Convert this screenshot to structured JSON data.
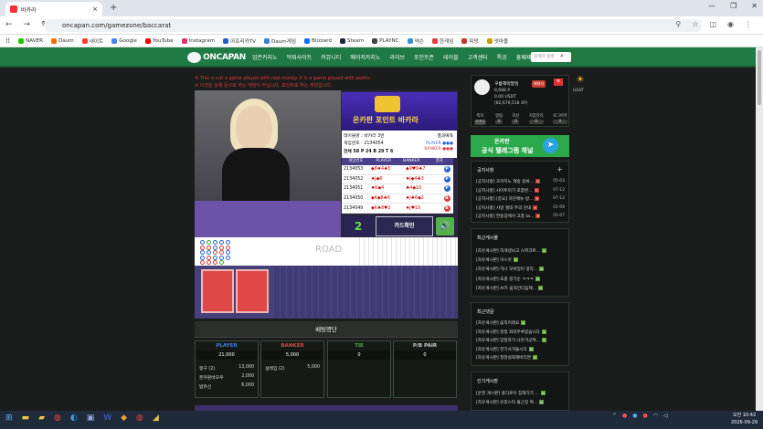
{
  "browser": {
    "tab_title": "바카라",
    "url": "oncapan.com/gamezone/baccarat"
  },
  "bookmarks": [
    "NAVER",
    "Daum",
    "네이트",
    "Google",
    "YouTube",
    "Instagram",
    "아프리카TV",
    "Daum게임",
    "Blizzard",
    "Steam",
    "PLAYNC",
    "넥슨",
    "한게임",
    "피망",
    "넷마블"
  ],
  "bookmark_colors": [
    "#1ec800",
    "#ff6a00",
    "#ff3b30",
    "#4285f4",
    "#ff0000",
    "#e1306c",
    "#1d5fc5",
    "#3f7cd8",
    "#0d6efd",
    "#1b2838",
    "#444",
    "#3b8ed8",
    "#e23b3b",
    "#c0392b",
    "#c9a000"
  ],
  "site": {
    "logo": "ONCAPAN",
    "menu": [
      "업존카지노",
      "먹튀사이트",
      "커뮤니티",
      "메이저카지노",
      "라이브",
      "포인트존",
      "테이블",
      "고객센터",
      "특공",
      "흥페제크"
    ],
    "search_placeholder": "검색어 입력",
    "light_label": "LIGHT"
  },
  "notices": [
    "※ This is not a game played with real money. It is a game played with points.",
    "※ 이것은 실제 돈으로 하는 게임이 아닙니다. 포인트로 하는 게임입니다."
  ],
  "game": {
    "banner": "온카판 포인트 바카라",
    "table_name": "테이블명 : 바카라 3번",
    "round": "게임번호 : 2134054",
    "stats": "전체 58 P 24 B 29 T 6",
    "result_label": "결과예측",
    "legend": [
      "PLAYER",
      "BANKER"
    ],
    "history_headers": [
      "게임번호",
      "PLAYER",
      "BANKER",
      "결과"
    ],
    "history": [
      {
        "id": "2134053",
        "player": "◆8♠4♣5",
        "banker": "◆9♥9♠7",
        "result": "P",
        "color": "#2563d4"
      },
      {
        "id": "2134052",
        "player": "♠J◆6",
        "banker": "♠J◆4♣3",
        "result": "P",
        "color": "#2563d4"
      },
      {
        "id": "2134051",
        "player": "♠K◆4",
        "banker": "♣4◆10",
        "result": "P",
        "color": "#2563d4"
      },
      {
        "id": "2134050",
        "player": "◆K◆8♣6",
        "banker": "♠J♣6◆2",
        "result": "B",
        "color": "#d43b3b"
      },
      {
        "id": "2134049",
        "player": "◆K♣8♥2",
        "banker": "♠J♥10",
        "result": "B",
        "color": "#d43b3b"
      }
    ],
    "countdown": "2",
    "card_button": "카드확인",
    "road_label": "ROAD"
  },
  "betting": {
    "title": "베팅명단",
    "columns": [
      {
        "name": "PLAYER",
        "color": "#3d7fe0",
        "total": "21,000",
        "rows": [
          {
            "user": "짱구 (2)",
            "amount": "13,000"
          },
          {
            "user": "온카판바오우",
            "amount": "2,000"
          },
          {
            "user": "밥쥬신",
            "amount": "6,000"
          }
        ]
      },
      {
        "name": "BANKER",
        "color": "#e04646",
        "total": "5,000",
        "rows": [
          {
            "user": "설레임 (2)",
            "amount": "5,000"
          }
        ]
      },
      {
        "name": "TIE",
        "color": "#49b04a",
        "total": "0",
        "rows": []
      },
      {
        "name": "P/B PAIR",
        "color": "#ccc",
        "total": "0",
        "rows": []
      }
    ]
  },
  "profile": {
    "name": "구름해먹알잉",
    "badge": "배재자",
    "point": "8,688 P",
    "usdt": "0.00 USDT",
    "xp": "(82,679,518 XP)",
    "stats": [
      {
        "label": "쪽지",
        "value": "쿠폰0"
      },
      {
        "label": "알림",
        "value": "0"
      },
      {
        "label": "지산",
        "value": "0"
      },
      {
        "label": "지갑관리",
        "value": "0"
      },
      {
        "label": "로그아웃",
        "value": "0"
      }
    ]
  },
  "telegram": {
    "line1": "온카판",
    "line2": "공식 텔레그램 채널"
  },
  "notice_box": {
    "title": "공지사항",
    "items": [
      {
        "text": "[공지사항] 호카지노 제송 중류...",
        "date": "05-03"
      },
      {
        "text": "[공지사항] 사이트이기 포함된...",
        "date": "07-12"
      },
      {
        "text": "[공지사항] [중요] 하단메뉴 방...",
        "date": "07-12"
      },
      {
        "text": "[공지사항] 사방 절대 주의 안내",
        "date": "01-09"
      },
      {
        "text": "[공지사항] 한송장에서 고총 ta...",
        "date": "02-07"
      }
    ]
  },
  "recent_posts": {
    "title": "최근게시물",
    "items": [
      "[자유게시판] 히개생보고 스파크트...",
      "[자유게시판] 이스앗",
      "[자유게시판] 하나 모바일미 골작...",
      "[자유게시판] 포괄 정기순 ㅋㅋㅋ",
      "[자유게시판] AI가 움직인다음제..."
    ]
  },
  "recent_comments": {
    "title": "최근댓글",
    "items": [
      "[자유게시판] 움직이래요",
      "[자유게시판] 정정 좌라주루받습니다",
      "[자유게시판] 앙정자가 나온거군여...",
      "[자유게시판] 한기사겨들시다",
      "[자유게시판] 청정실좌해버리면"
    ]
  },
  "popular": {
    "title": "인기게시판",
    "items": [
      "[운영 게시판] 골디로이 집해가기 ...",
      "[자유게시판] 유후스타 출근길 여..."
    ]
  },
  "taskbar": {
    "time": "오전 10:42",
    "date": "2026-09-29"
  }
}
